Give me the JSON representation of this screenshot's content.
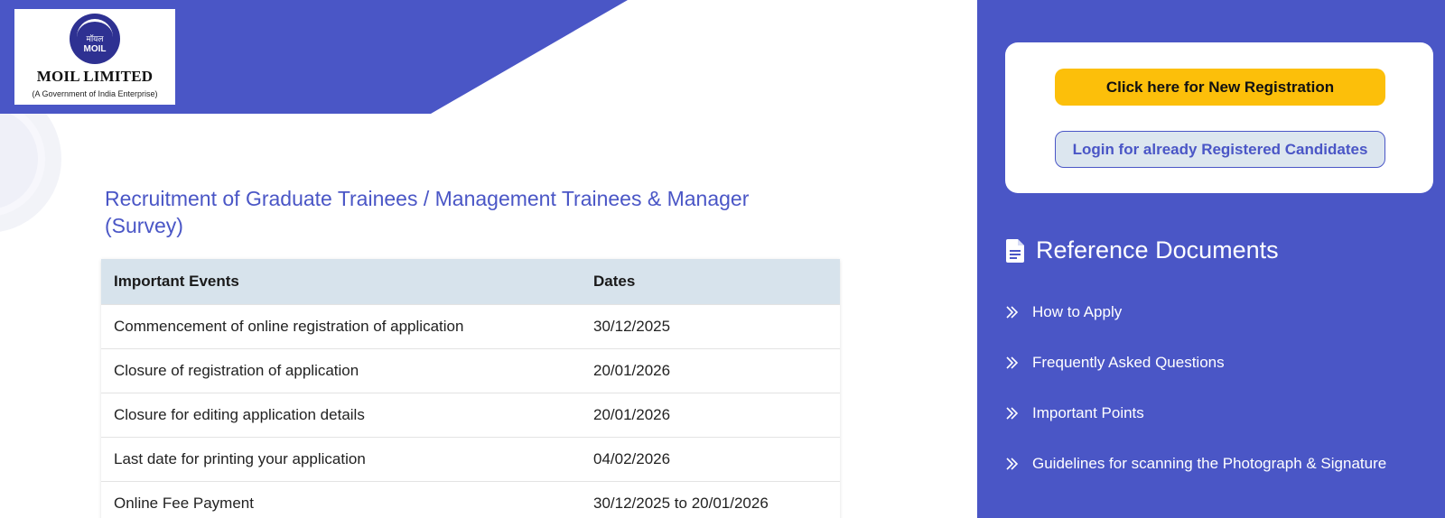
{
  "colors": {
    "brand": "#4a56c6",
    "accent_button": "#fcbf0a",
    "table_header": "#d7e3ec",
    "logo_blue": "#2e3192"
  },
  "logo": {
    "hindi_text": "मॉयल",
    "short_name": "MOIL",
    "name": "MOIL LIMITED",
    "tagline": "(A Government of India Enterprise)"
  },
  "main": {
    "title": "Recruitment of Graduate Trainees / Management Trainees & Manager (Survey)",
    "table": {
      "headers": [
        "Important Events",
        "Dates"
      ],
      "rows": [
        {
          "event": "Commencement of online registration of application",
          "date": "30/12/2025"
        },
        {
          "event": "Closure of registration of application",
          "date": "20/01/2026"
        },
        {
          "event": "Closure for editing application details",
          "date": "20/01/2026"
        },
        {
          "event": "Last date for printing your application",
          "date": "04/02/2026"
        },
        {
          "event": "Online Fee Payment",
          "date": "30/12/2025 to 20/01/2026"
        }
      ]
    }
  },
  "sidebar": {
    "new_registration_label": "Click here for New Registration",
    "login_label": "Login for already Registered Candidates",
    "reference_title": "Reference Documents",
    "reference_icon": "document-icon",
    "reference_items": [
      {
        "label": "How to Apply",
        "icon": "double-chevron-right-icon"
      },
      {
        "label": "Frequently Asked Questions",
        "icon": "double-chevron-right-icon"
      },
      {
        "label": "Important Points",
        "icon": "double-chevron-right-icon"
      },
      {
        "label": "Guidelines for scanning the Photograph & Signature",
        "icon": "double-chevron-right-icon"
      }
    ]
  }
}
